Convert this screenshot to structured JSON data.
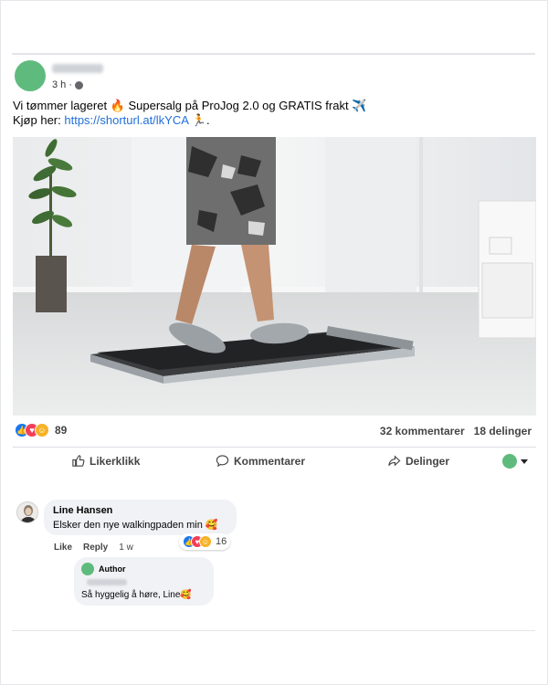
{
  "post": {
    "time": "3 h ·",
    "text_line1": "Vi tømmer lageret 🔥 Supersalg på ProJog 2.0 og GRATIS frakt ✈️",
    "text_line2_prefix": "Kjøp her: ",
    "link": "https://shorturl.at/lkYCA",
    "text_line2_suffix": " 🏃."
  },
  "stats": {
    "reaction_count": "89",
    "comments": "32 kommentarer",
    "shares": "18 delinger"
  },
  "actions": {
    "like": "Likerklikk",
    "comment": "Kommentarer",
    "share": "Delinger"
  },
  "comment": {
    "author": "Line Hansen",
    "text": "Elsker den nye walkingpaden min 🥰",
    "reaction_count": "16",
    "like": "Like",
    "reply": "Reply",
    "age": "1 w"
  },
  "reply": {
    "author": "Author",
    "text": "Så hyggelig å høre, Line🥰"
  },
  "colors": {
    "accent": "#1877f2",
    "avatar_green": "#5fbb7d",
    "link": "#216fdb"
  }
}
